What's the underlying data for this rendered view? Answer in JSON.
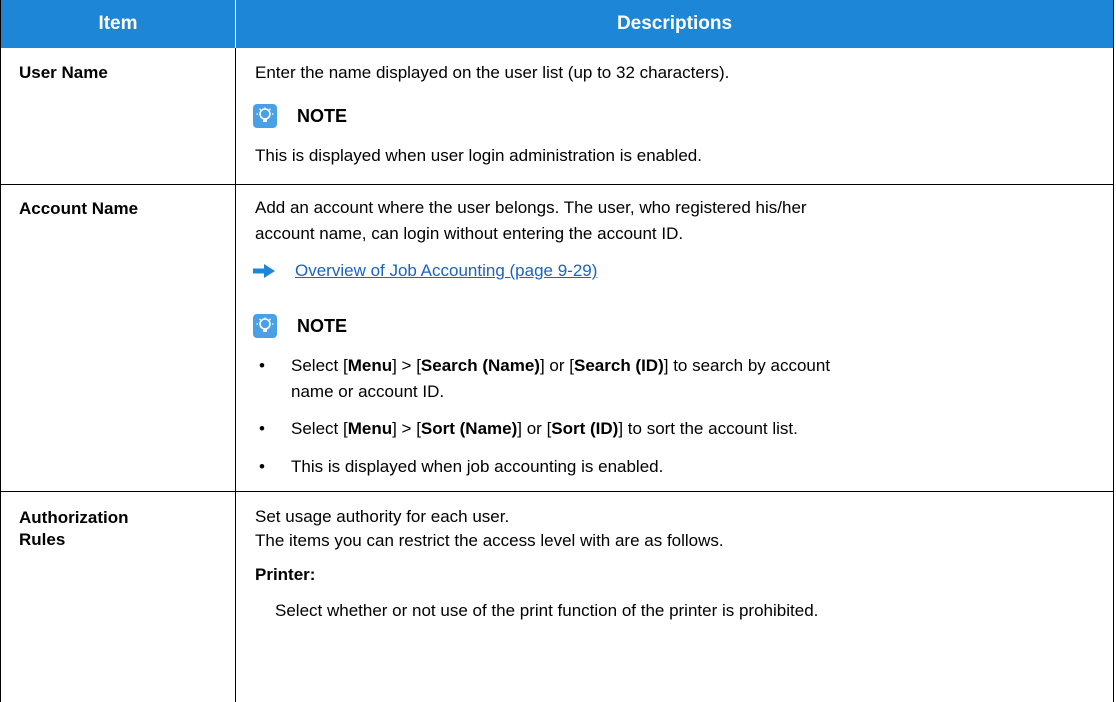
{
  "header": {
    "item": "Item",
    "descriptions": "Descriptions"
  },
  "rows": [
    {
      "item": "User Name",
      "description": "Enter the name displayed on the user list (up to 32 characters).",
      "note_label": "NOTE",
      "note_text": "This is displayed when user login administration is enabled."
    },
    {
      "item": "Account Name",
      "description_line1": "Add an account where the user belongs. The user, who registered his/her",
      "description_line2": "account name, can login without entering the account ID.",
      "link": "Overview of Job Accounting (page 9-29)",
      "note_label": "NOTE",
      "bullets": [
        {
          "b1_pre": "Select [",
          "b1_menu": "Menu",
          "b1_mid1": "] > [",
          "b1_s1": "Search (Name)",
          "b1_mid2": "] or [",
          "b1_s2": "Search (ID)",
          "b1_post": "] to search by account",
          "line2": "name or account ID."
        },
        {
          "b2_pre": "Select [",
          "b2_menu": "Menu",
          "b2_mid1": "] > [",
          "b2_s1": "Sort (Name)",
          "b2_mid2": "] or [",
          "b2_s2": "Sort (ID)",
          "b2_post": "] to sort the account list."
        },
        {
          "text": "This is displayed when job accounting is enabled."
        }
      ]
    },
    {
      "item_line1": "Authorization",
      "item_line2": "Rules",
      "line1": "Set usage authority for each user.",
      "line2": "The items you can restrict the access level with are as follows.",
      "sub_title": "Printer:",
      "sub_text": "Select whether or not use of the print function of the printer is prohibited."
    }
  ],
  "bullet_char": "•",
  "colors": {
    "header_bg": "#1e86d6",
    "link": "#1a63c4",
    "note_icon": "#4aa0e6"
  }
}
